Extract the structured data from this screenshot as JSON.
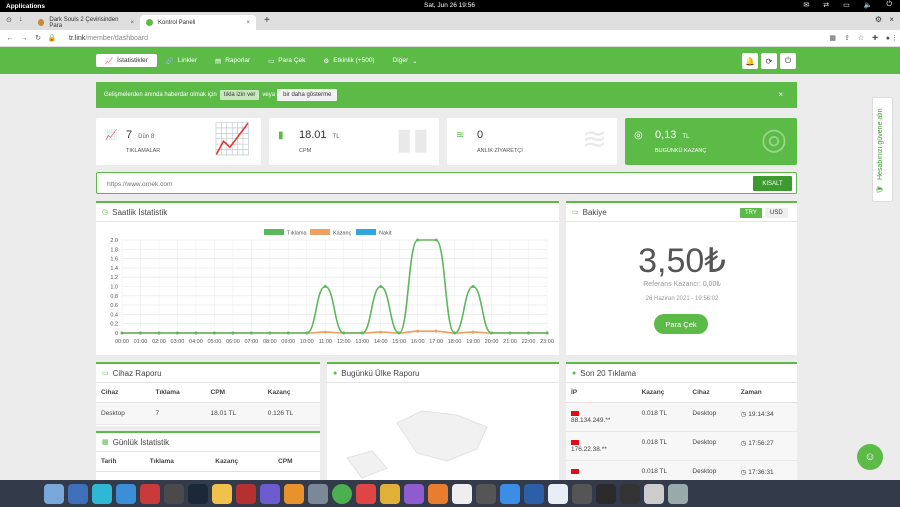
{
  "system_bar": {
    "apps": "Applications",
    "clock": "Sat, Jun 26    19:56"
  },
  "browser": {
    "tabs": [
      {
        "label": "Dark Souls 2 Çevirisinden Para"
      },
      {
        "label": "Kontrol Paneli"
      }
    ],
    "url_host": "tr.link",
    "url_path": "/member/dashboard"
  },
  "nav": {
    "items": [
      {
        "label": "İstatistikler",
        "icon": "chart-icon"
      },
      {
        "label": "Linkler",
        "icon": "link-icon"
      },
      {
        "label": "Raporlar",
        "icon": "report-icon"
      },
      {
        "label": "Para Çek",
        "icon": "money-icon"
      },
      {
        "label": "Etkinlik (+500)",
        "icon": "gear-icon"
      },
      {
        "label": "Diğer",
        "icon": "chevron-down-icon"
      }
    ]
  },
  "alert": {
    "text": "Gelişmelerden anında haberdar olmak için",
    "button1": "tıkla izin ver",
    "middle": "veya",
    "button2": "bir daha gösterme",
    "close": "×"
  },
  "cards": [
    {
      "value": "7",
      "sub": "Dün 8",
      "label": "TIKLAMALAR"
    },
    {
      "value": "18.01",
      "sub": "TL",
      "label": "CPM"
    },
    {
      "value": "0",
      "sub": "",
      "label": "ANLIK ZİYARETÇİ"
    },
    {
      "value": "0,13",
      "sub": "TL",
      "label": "BUGÜNKÜ KAZANÇ"
    }
  ],
  "shortener": {
    "placeholder": "https://www.ornek.com",
    "button": "KISALT"
  },
  "hourly": {
    "title": "Saatlik İstatistik",
    "legend": [
      "Tıklama",
      "Kazanç",
      "Nakit"
    ]
  },
  "chart_data": {
    "type": "line",
    "x": [
      "00:00",
      "01:00",
      "02:00",
      "03:00",
      "04:00",
      "05:00",
      "06:00",
      "07:00",
      "08:00",
      "09:00",
      "10:00",
      "11:00",
      "12:00",
      "13:00",
      "14:00",
      "15:00",
      "16:00",
      "17:00",
      "18:00",
      "19:00",
      "20:00",
      "21:00",
      "22:00",
      "23:00"
    ],
    "y_ticks": [
      "0",
      "0.2",
      "0.4",
      "0.6",
      "0.8",
      "1.0",
      "1.2",
      "1.4",
      "1.6",
      "1.8",
      "2.0"
    ],
    "series": [
      {
        "name": "Tıklama",
        "color": "#5cb85c",
        "values": [
          0,
          0,
          0,
          0,
          0,
          0,
          0,
          0,
          0,
          0,
          0,
          1,
          0,
          0,
          1,
          0,
          2,
          2,
          0,
          1,
          0,
          0,
          0,
          0
        ]
      },
      {
        "name": "Kazanç",
        "color": "#f0a060",
        "values": [
          0,
          0,
          0,
          0,
          0,
          0,
          0,
          0,
          0,
          0,
          0,
          0.02,
          0,
          0,
          0.02,
          0,
          0.04,
          0.04,
          0,
          0.02,
          0,
          0,
          0,
          0
        ]
      }
    ],
    "ylim": [
      0,
      2.0
    ],
    "grid": true,
    "legend": "top"
  },
  "balance": {
    "title": "Bakiye",
    "cur1": "TRY",
    "cur2": "USD",
    "amount": "3,50₺",
    "ref": "Referans Kazancı: 0,00₺",
    "date": "26 Haziran 2021 - 19:56:02",
    "button": "Para Çek"
  },
  "device": {
    "title": "Cihaz Raporu",
    "headers": [
      "Cihaz",
      "Tıklama",
      "CPM",
      "Kazanç"
    ],
    "rows": [
      [
        "Desktop",
        "7",
        "18.01 TL",
        "0.126 TL"
      ]
    ]
  },
  "daily": {
    "title": "Günlük İstatistik",
    "headers": [
      "Tarih",
      "Tıklama",
      "Kazanç",
      "CPM"
    ]
  },
  "country": {
    "title": "Bugünkü Ülke Raporu"
  },
  "last20": {
    "title": "Son 20 Tıklama",
    "headers": [
      "İP",
      "Kazanç",
      "Cihaz",
      "Zaman"
    ],
    "rows": [
      [
        "88.134.249.**",
        "0.018 TL",
        "Desktop",
        "19:14:34"
      ],
      [
        "176.22.38.**",
        "0.018 TL",
        "Desktop",
        "17:56:27"
      ],
      [
        "",
        "0.018 TL",
        "Desktop",
        "17:36:31"
      ]
    ]
  },
  "side": {
    "text": "Hesabınızı güvene alın"
  }
}
